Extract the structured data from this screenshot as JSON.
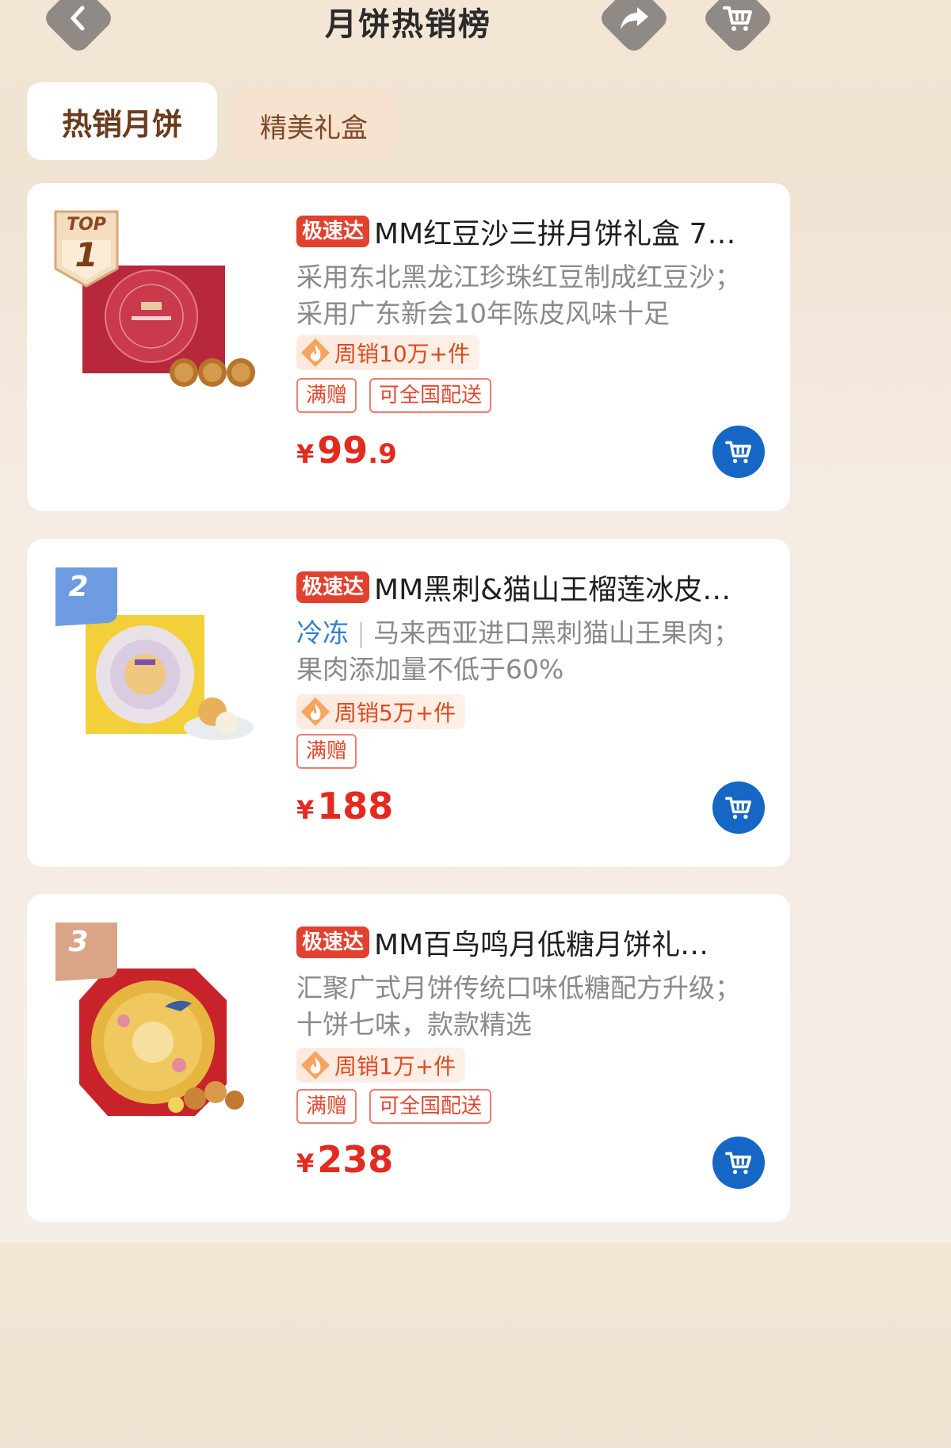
{
  "header": {
    "title": "月饼热销榜"
  },
  "tabs": [
    {
      "label": "热销月饼",
      "active": true
    },
    {
      "label": "精美礼盒",
      "active": false
    }
  ],
  "products": [
    {
      "rank_label": "TOP",
      "rank": "1",
      "tag": "极速达",
      "title": "MM红豆沙三拼月饼礼盒 7…",
      "desc_prefix": "",
      "desc": "采用东北黑龙江珍珠红豆制成红豆沙；采用广东新会10年陈皮风味十足",
      "sales": "周销10万+件",
      "tags": [
        "满赠",
        "可全国配送"
      ],
      "price_symbol": "¥",
      "price_int": "99",
      "price_dec": ".9"
    },
    {
      "rank_label": "",
      "rank": "2",
      "tag": "极速达",
      "title": "MM黑刺&猫山王榴莲冰皮…",
      "desc_prefix": "冷冻",
      "desc": "马来西亚进口黑刺猫山王果肉；果肉添加量不低于60%",
      "sales": "周销5万+件",
      "tags": [
        "满赠"
      ],
      "price_symbol": "¥",
      "price_int": "188",
      "price_dec": ""
    },
    {
      "rank_label": "",
      "rank": "3",
      "tag": "极速达",
      "title": "MM百鸟鸣月低糖月饼礼…",
      "desc_prefix": "",
      "desc": "汇聚广式月饼传统口味低糖配方升级；十饼七味，款款精选",
      "sales": "周销1万+件",
      "tags": [
        "满赠",
        "可全国配送"
      ],
      "price_symbol": "¥",
      "price_int": "238",
      "price_dec": ""
    }
  ],
  "colors": {
    "accent_red": "#e42a1f",
    "cart_blue": "#1566c5",
    "cold_blue": "#2f7fd1",
    "tab_brown": "#6b3b1c"
  }
}
